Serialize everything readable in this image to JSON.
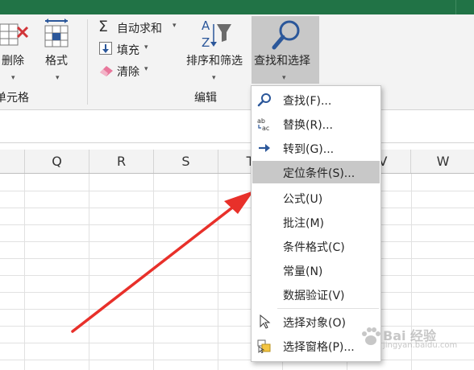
{
  "ribbon": {
    "cells_group": {
      "delete_label": "删除",
      "format_label": "格式",
      "group_label": "单元格"
    },
    "editing_group": {
      "autosum_label": "自动求和",
      "fill_label": "填充",
      "clear_label": "清除",
      "sort_filter_label": "排序和筛选",
      "find_select_label": "查找和选择",
      "group_label": "编辑"
    }
  },
  "columns": [
    "Q",
    "R",
    "S",
    "T",
    "V",
    "W"
  ],
  "menu": {
    "items": [
      {
        "label": "查找(F)...",
        "icon": "search-icon"
      },
      {
        "label": "替换(R)...",
        "icon": "replace-icon"
      },
      {
        "label": "转到(G)...",
        "icon": "arrow-right-icon"
      },
      {
        "label": "定位条件(S)...",
        "icon": "",
        "highlighted": true
      },
      {
        "label": "公式(U)",
        "icon": ""
      },
      {
        "label": "批注(M)",
        "icon": ""
      },
      {
        "label": "条件格式(C)",
        "icon": ""
      },
      {
        "label": "常量(N)",
        "icon": ""
      },
      {
        "label": "数据验证(V)",
        "icon": ""
      },
      {
        "label": "选择对象(O)",
        "icon": "cursor-icon"
      },
      {
        "label": "选择窗格(P)...",
        "icon": "selection-pane-icon"
      }
    ]
  },
  "watermark": {
    "text": "Bai 经验",
    "sub": "jingyan.baidu.com"
  },
  "colors": {
    "title_bar": "#217346",
    "highlight": "#c8c8c8",
    "arrow": "#e8302a",
    "accent_blue": "#2b579a"
  }
}
